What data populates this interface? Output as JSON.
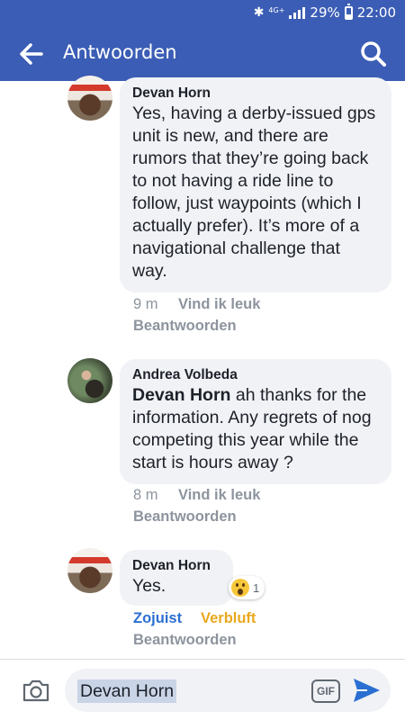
{
  "status_bar": {
    "network": "4G+",
    "battery": "29%",
    "time": "22:00"
  },
  "header": {
    "title": "Antwoorden",
    "back_icon": "arrow-left-icon",
    "search_icon": "search-icon"
  },
  "comments": [
    {
      "author": "Devan Horn",
      "text": "Yes, having a derby-issued gps unit is new, and there are rumors that they’re going back to not having a ride line to follow, just waypoints (which I actually prefer). It’s more of a navigational challenge that way.",
      "time": "9 m",
      "like_label": "Vind ik leuk",
      "reply_label": "Beantwoorden"
    },
    {
      "author": "Andrea Volbeda",
      "mention": "Devan Horn",
      "text": " ah thanks for the information. Any regrets of nog competing this year while the start is hours away ?",
      "time": "8 m",
      "like_label": "Vind ik leuk",
      "reply_label": "Beantwoorden"
    },
    {
      "author": "Devan Horn",
      "text": "Yes.",
      "time": "Zojuist",
      "reaction_label": "Verbluft",
      "reaction_count": "1",
      "reply_label": "Beantwoorden"
    }
  ],
  "composer": {
    "input_value": "Devan Horn",
    "gif_label": "GIF",
    "camera_icon": "camera-icon",
    "send_icon": "send-icon"
  },
  "colors": {
    "brand_blue": "#3b5db5",
    "bubble": "#f1f2f6",
    "link_blue": "#2a6fd1",
    "wow_yellow": "#e9a81c"
  }
}
